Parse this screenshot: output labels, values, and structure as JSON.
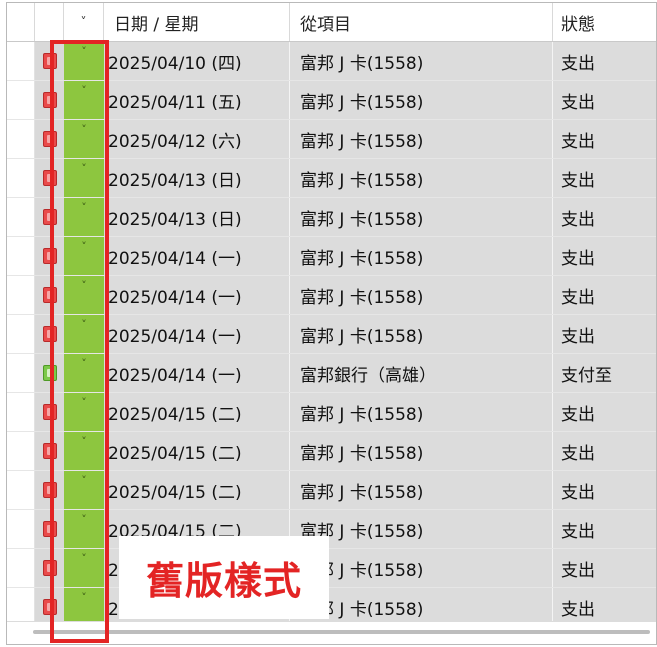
{
  "grid": {
    "columns": [
      {
        "key": "blank",
        "label": ""
      },
      {
        "key": "type_icon",
        "label": ""
      },
      {
        "key": "expand",
        "label": "˅"
      },
      {
        "key": "date",
        "label": "日期 / 星期"
      },
      {
        "key": "account",
        "label": "從項目"
      },
      {
        "key": "status",
        "label": "狀態"
      }
    ],
    "rows": [
      {
        "icon": "red-card-icon",
        "chevron": "˅",
        "date": "2025/04/10 (四)",
        "account": "富邦 J 卡(1558)",
        "status": "支出"
      },
      {
        "icon": "red-card-icon",
        "chevron": "˅",
        "date": "2025/04/11 (五)",
        "account": "富邦 J 卡(1558)",
        "status": "支出"
      },
      {
        "icon": "red-card-icon",
        "chevron": "˅",
        "date": "2025/04/12 (六)",
        "account": "富邦 J 卡(1558)",
        "status": "支出"
      },
      {
        "icon": "red-card-icon",
        "chevron": "˅",
        "date": "2025/04/13 (日)",
        "account": "富邦 J 卡(1558)",
        "status": "支出"
      },
      {
        "icon": "red-card-icon",
        "chevron": "˅",
        "date": "2025/04/13 (日)",
        "account": "富邦 J 卡(1558)",
        "status": "支出"
      },
      {
        "icon": "red-card-icon",
        "chevron": "˅",
        "date": "2025/04/14 (一)",
        "account": "富邦 J 卡(1558)",
        "status": "支出"
      },
      {
        "icon": "red-card-icon",
        "chevron": "˅",
        "date": "2025/04/14 (一)",
        "account": "富邦 J 卡(1558)",
        "status": "支出"
      },
      {
        "icon": "red-card-icon",
        "chevron": "˅",
        "date": "2025/04/14 (一)",
        "account": "富邦 J 卡(1558)",
        "status": "支出"
      },
      {
        "icon": "green-bank-icon",
        "chevron": "˅",
        "date": "2025/04/14 (一)",
        "account": "富邦銀行（高雄）",
        "status": "支付至"
      },
      {
        "icon": "red-card-icon",
        "chevron": "˅",
        "date": "2025/04/15 (二)",
        "account": "富邦 J 卡(1558)",
        "status": "支出"
      },
      {
        "icon": "red-card-icon",
        "chevron": "˅",
        "date": "2025/04/15 (二)",
        "account": "富邦 J 卡(1558)",
        "status": "支出"
      },
      {
        "icon": "red-card-icon",
        "chevron": "˅",
        "date": "2025/04/15 (二)",
        "account": "富邦 J 卡(1558)",
        "status": "支出"
      },
      {
        "icon": "red-card-icon",
        "chevron": "˅",
        "date": "2025/04/15 (二)",
        "account": "富邦 J 卡(1558)",
        "status": "支出"
      },
      {
        "icon": "red-card-icon",
        "chevron": "˅",
        "date": "2025/04/16 (三)",
        "account": "富邦 J 卡(1558)",
        "status": "支出"
      },
      {
        "icon": "red-card-icon",
        "chevron": "˅",
        "date": "2025/04/17 (四)",
        "account": "富邦 J 卡(1558)",
        "status": "支出"
      }
    ]
  },
  "annotation": {
    "label": "舊版樣式",
    "color": "#e32424"
  },
  "colors": {
    "expand_column": "#8dc63f",
    "row_background": "#dcdcdc",
    "expense_icon": "#e94b4b",
    "transfer_icon": "#7cc94a"
  }
}
